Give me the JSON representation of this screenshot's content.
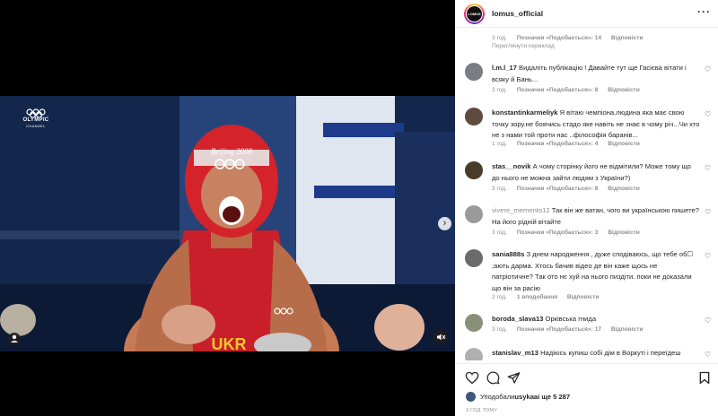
{
  "media": {
    "channel_name": "OLYMPIC",
    "channel_sub": "CHANNEL",
    "headgear_text": "Beijing 2008",
    "jersey_text": "UKR"
  },
  "post": {
    "username": "lomus_official",
    "avatar_text": "LOMUS",
    "likes_text_prefix": "Уподобали ",
    "liker": "usykaa",
    "likes_text_suffix": " і ще 5 287",
    "time_ago": "3 ГОД ТОМУ"
  },
  "comments": [
    {
      "user": "",
      "text": "",
      "time": "3 год.",
      "likes": "Позначки «Подобається»: 14",
      "reply": "Відповісти",
      "translate": "Переглянути переклад",
      "avatar_color": "#ffffff"
    },
    {
      "user": "l.m.l_17",
      "text": "Видаліть публікацію ! Давайте тут ще Гасієва вітати і всяку й  Бань...",
      "time": "3 год.",
      "likes": "Позначки «Подобається»: 8",
      "reply": "Відповісти",
      "avatar_color": "#7a7d84"
    },
    {
      "user": "konstantinkarmeliyk",
      "text": "Я вітаю чемпіона.людина яка має свою точку зору.не боячись стадо яке навіть не знає в чому річ...Чи хто не з нами той проти нас ..філософія баранів...",
      "time": "1 год.",
      "likes": "Позначки «Подобається»: 4",
      "reply": "Відповісти",
      "avatar_color": "#5f4a3d"
    },
    {
      "user": "stas__novik",
      "text": "А чому сторінку його не відмітили? Може тому що до нього не можна зайти людям з України?)",
      "time": "3 год.",
      "likes": "Позначки «Подобається»: 8",
      "reply": "Відповісти",
      "avatar_color": "#4a3a2a"
    },
    {
      "user": "vivere_memento12",
      "text": "Так він же ватан, чого ви українською пишете? На його рідній вітайте",
      "time": "3 год.",
      "likes": "Позначки «Подобається»: 3",
      "reply": "Відповісти",
      "avatar_color": "#9a9a9a"
    },
    {
      "user": "sania888s",
      "text": "З днем народження , дуже сподіваюсь, що тебе об☐ ;ають дарма. Хтось бачив відео де він каже щось не патріотичне? Так ото нє хуй на нього пиздіти. поки не доказали що він за расію",
      "time": "2 год.",
      "likes": "1 вподобання",
      "reply": "Відповісти",
      "avatar_color": "#6b6b6b"
    },
    {
      "user": "boroda_slava13",
      "text": "Орківська гнида",
      "time": "3 год.",
      "likes": "Позначки «Подобається»: 17",
      "reply": "Відповісти",
      "avatar_color": "#8a8f7a"
    },
    {
      "user": "stanislav_m13",
      "text": "Надіюсь купиш собі дім в Воркуті і переїдеш",
      "time": "",
      "likes": "",
      "reply": "",
      "avatar_color": "#b0b0b0"
    }
  ]
}
